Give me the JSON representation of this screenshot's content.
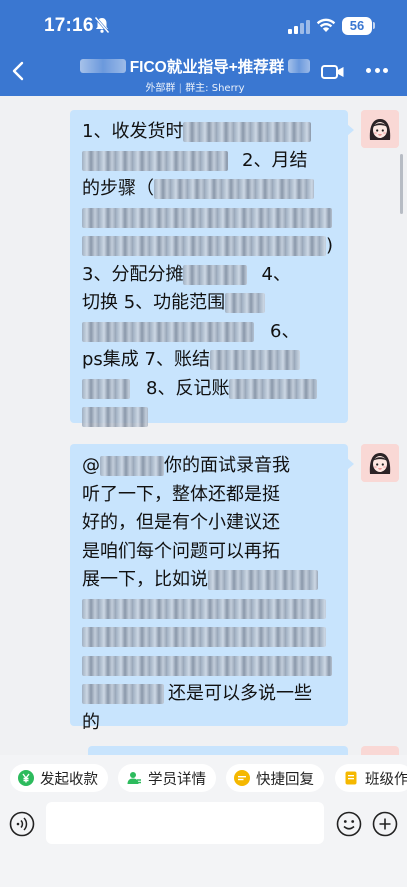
{
  "status": {
    "time": "17:16",
    "battery": "56"
  },
  "header": {
    "title_visible": "FICO就业指导+推荐群",
    "subtitle_tag": "外部群",
    "subtitle_owner": "群主: Sherry"
  },
  "messages": [
    {
      "text_parts": [
        "1、收发货时",
        "2、月结",
        "的步骤（",
        ")",
        "3、分配分摊",
        "4、",
        "切换 5、功能范围",
        "6、",
        "ps集成 7、账结",
        "8、反记账"
      ]
    },
    {
      "text_parts": [
        "@",
        "你的面试录音我",
        "听了一下，整体还都是挺",
        "好的，但是有个小建议还",
        "是咱们每个问题可以再拓",
        "展一下，比如说",
        "还是可以多说一些",
        "的"
      ]
    }
  ],
  "quick_actions": [
    {
      "label": "发起收款",
      "icon": "yen-icon",
      "color": "#2dbb5d"
    },
    {
      "label": "学员详情",
      "icon": "user-icon",
      "color": "#2dbb5d"
    },
    {
      "label": "快捷回复",
      "icon": "chat-icon",
      "color": "#f5b800"
    },
    {
      "label": "班级作",
      "icon": "doc-icon",
      "color": "#f5b800"
    }
  ],
  "input": {
    "placeholder": ""
  },
  "colors": {
    "header": "#3a77d1",
    "bubble": "#c8e4fd",
    "background": "#f0f1f3"
  }
}
